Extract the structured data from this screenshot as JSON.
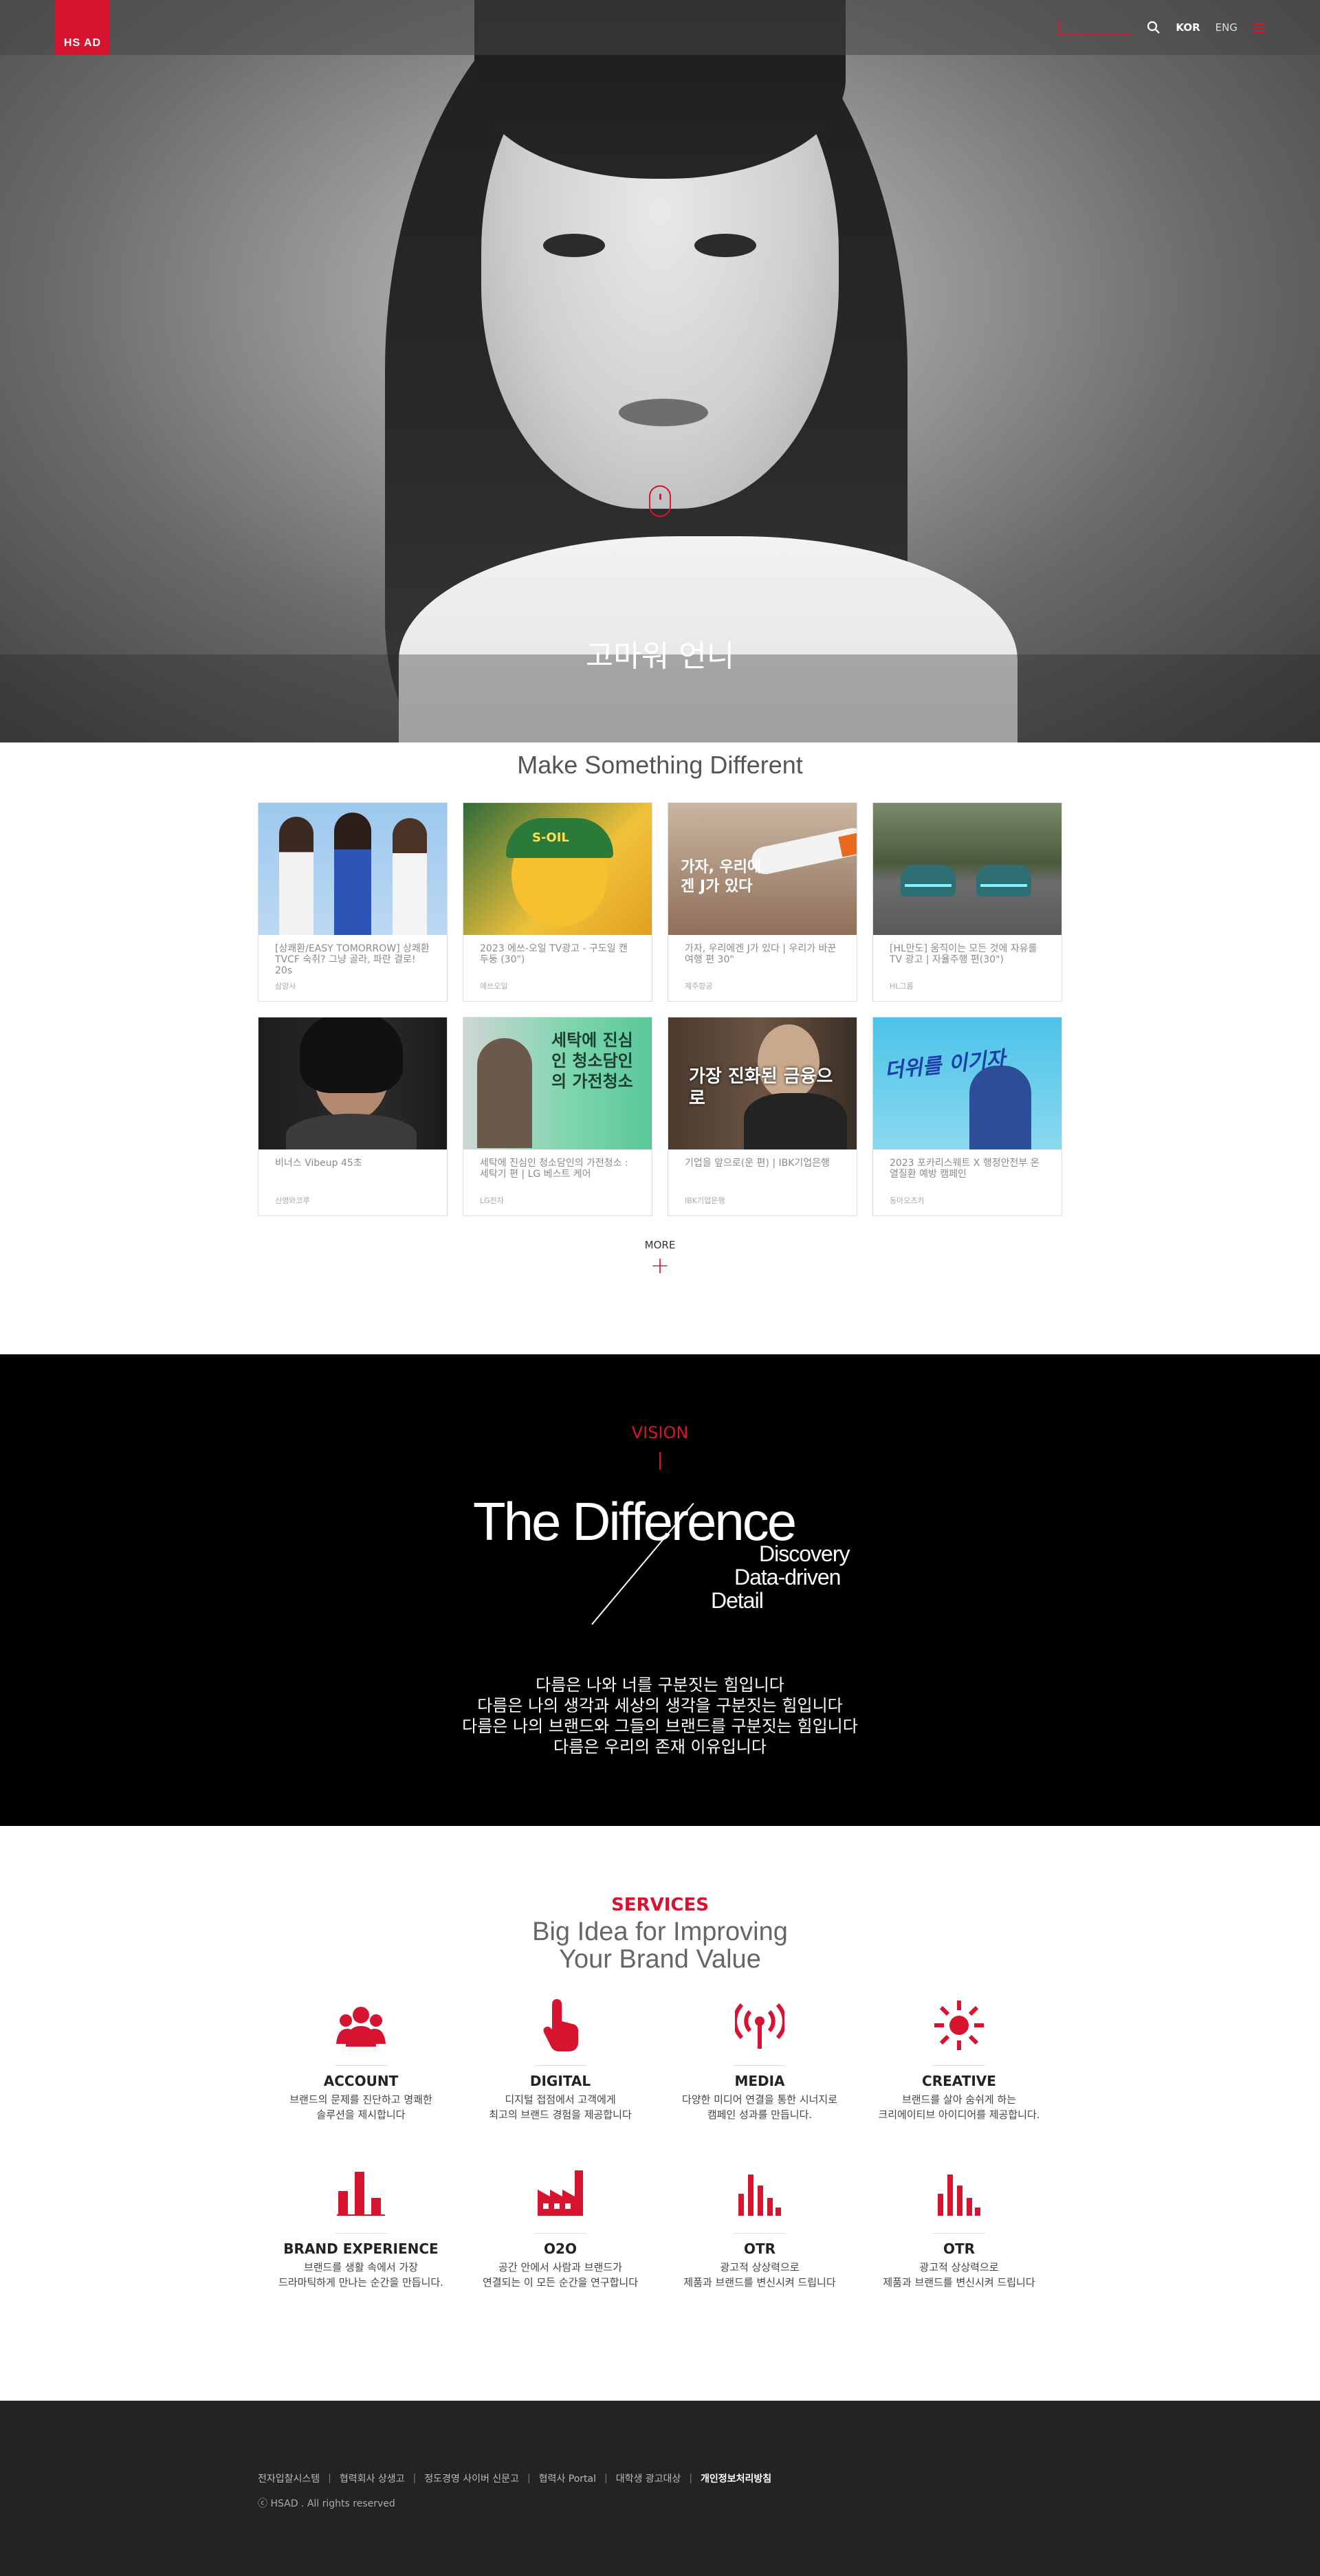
{
  "header": {
    "logo_text": "HS AD",
    "recruit_label": "",
    "lang_kor": "KOR",
    "lang_eng": "ENG",
    "colors": {
      "accent": "#d7142f"
    }
  },
  "hero": {
    "caption": "고마워 언니"
  },
  "works": {
    "title": "Make Something Different",
    "more_label": "MORE",
    "more_icon": "+",
    "items": [
      {
        "title": "[상쾌환/EASY TOMORROW] 상쾌환 TVCF 숙취? 그냥 골라, 파란 결로! 20s",
        "category": "삼양사",
        "thumb_text": ""
      },
      {
        "title": "2023 에쓰-오일 TV광고 - 구도일 캔 두둥 (30\")",
        "category": "에쓰오일",
        "thumb_text": "S-OIL"
      },
      {
        "title": "가자, 우리에겐 J가 있다 | 우리가 바꾼 여행 편 30\"",
        "category": "제주항공",
        "thumb_text": "가자, 우리에겐 J가 있다"
      },
      {
        "title": "[HL만도] 움직이는 모든 것에 자유를 TV 광고 | 자율주행 편(30\")",
        "category": "HL그룹",
        "thumb_text": ""
      },
      {
        "title": "비너스 Vibeup 45초",
        "category": "신영와코루",
        "thumb_text": ""
      },
      {
        "title": "세탁에 진심인 청소담인의 가전청소 : 세탁기 편 | LG 베스트 케어",
        "category": "LG전자",
        "thumb_text": "세탁에 진심인 청소담인의 가전청소"
      },
      {
        "title": "기업을 앞으로(운 편) | IBK기업은행",
        "category": "IBK기업은행",
        "thumb_text": "가장 진화된 금융으로"
      },
      {
        "title": "2023 포카리스웨트 X 행정안전부 온열질환 예방 캠페인",
        "category": "동아오츠카",
        "thumb_text": "더위를 이기자"
      }
    ]
  },
  "vision": {
    "label": "VISION",
    "headline": "The Difference",
    "sub": [
      "Discovery",
      "Data-driven",
      "Detail"
    ],
    "lines": [
      "다름은 나와 너를 구분짓는 힘입니다",
      "다름은 나의 생각과 세상의 생각을 구분짓는 힘입니다",
      "다름은 나의 브랜드와 그들의 브랜드를 구분짓는 힘입니다",
      "다름은 우리의 존재 이유입니다"
    ]
  },
  "services": {
    "label": "SERVICES",
    "title_line1": "Big Idea for Improving",
    "title_line2": "Your Brand Value",
    "items": [
      {
        "name": "ACCOUNT",
        "icon": "people-icon",
        "desc1": "브랜드의 문제를 진단하고 명쾌한",
        "desc2": "솔루션을 제시합니다"
      },
      {
        "name": "DIGITAL",
        "icon": "touch-icon",
        "desc1": "디지털 접점에서 고객에게",
        "desc2": "최고의 브랜드 경험을 제공합니다"
      },
      {
        "name": "MEDIA",
        "icon": "broadcast-icon",
        "desc1": "다양한 미디어 연결을 통한 시너지로",
        "desc2": "캠페인 성과를 만듭니다."
      },
      {
        "name": "CREATIVE",
        "icon": "idea-icon",
        "desc1": "브랜드를 살아 숨쉬게 하는",
        "desc2": "크리에이티브 아이디어를 제공합니다."
      },
      {
        "name": "BRAND EXPERIENCE",
        "icon": "bar-chart-icon",
        "desc1": "브랜드를 생활 속에서 가장",
        "desc2": "드라마틱하게 만나는 순간을 만듭니다."
      },
      {
        "name": "O2O",
        "icon": "factory-icon",
        "desc1": "공간 안에서 사람과 브랜드가",
        "desc2": "연결되는 이 모든 순간을 연구합니다"
      },
      {
        "name": "OTR",
        "icon": "bar-chart-icon",
        "desc1": "광고적 상상력으로",
        "desc2": "제품과 브랜드를 변신시켜 드립니다"
      },
      {
        "name": "OTR",
        "icon": "bar-chart-icon",
        "desc1": "광고적 상상력으로",
        "desc2": "제품과 브랜드를 변신시켜 드립니다"
      }
    ]
  },
  "footer": {
    "links": [
      "전자입찰시스템",
      "협력회사 상생고",
      "정도경영 사이버 신문고",
      "협력사 Portal",
      "대학생 광고대상",
      "개인정보처리방침"
    ],
    "copyright": "ⓒ HSAD . All rights reserved"
  }
}
